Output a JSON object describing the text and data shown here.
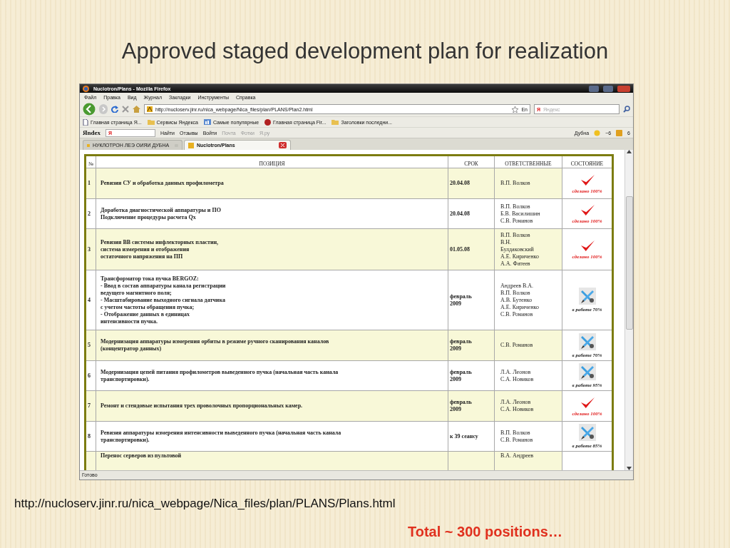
{
  "slide": {
    "title": "Approved staged development plan for realization",
    "source_url": "http://nucloserv.jinr.ru/nica_webpage/Nica_files/plan/PLANS/Plans.html",
    "footer_note": "Total ~ 300 positions…"
  },
  "browser": {
    "window_title": "Nuclotron/Plans - Mozilla Firefox",
    "menu": [
      "Файл",
      "Правка",
      "Вид",
      "Журнал",
      "Закладки",
      "Инструменты",
      "Справка"
    ],
    "address": "http://nucloserv.jinr.ru/nica_webpage/Nica_files/plan/PLANS/Plan2.html",
    "language": "En",
    "search_engine": "Я",
    "search_placeholder": "Яндекс",
    "bookmarks": [
      {
        "label": "Главная страница Я...",
        "kind": "page"
      },
      {
        "label": "Сервисы Яндекса",
        "kind": "folder"
      },
      {
        "label": "Самые популярные",
        "kind": "smart"
      },
      {
        "label": "Главная страница Fir...",
        "kind": "firefox"
      },
      {
        "label": "Заголовки последни...",
        "kind": "folder"
      }
    ],
    "yandex_bar": {
      "logo": "Яndex",
      "field_value": "Я",
      "items": [
        {
          "label": "Найти",
          "disabled": false
        },
        {
          "label": "Отзывы",
          "disabled": false
        },
        {
          "label": "Войти",
          "disabled": false
        },
        {
          "label": "Почта",
          "disabled": true
        },
        {
          "label": "Фотки",
          "disabled": true
        },
        {
          "label": "Я.ру",
          "disabled": true
        }
      ],
      "city": "Дубна",
      "temperature": "−6",
      "mail_count": "6"
    },
    "tabs": [
      {
        "label": "НУКЛОТРОН ЛЕЭ ОИЯИ ДУБНА",
        "selected": false
      },
      {
        "label": "Nuclotron/Plans",
        "selected": true
      }
    ],
    "status_bar": "Готово"
  },
  "table": {
    "columns": [
      "№",
      "ПОЗИЦИЯ",
      "СРОК",
      "ОТВЕТСТВЕННЫЕ",
      "СОСТОЯНИЕ"
    ],
    "rows": [
      {
        "number": "1",
        "position": "Ревизия СУ и обработка данных профилометра",
        "deadline": "20.04.08",
        "responsible": "В.П. Волков",
        "status": {
          "kind": "done",
          "label": "сделано 100%"
        }
      },
      {
        "number": "2",
        "position": "Доработка диагностической аппаратуры и ПО\nПодключение процедуры расчета Qx",
        "deadline": "20.04.08",
        "responsible": "В.П. Волков\nБ.В. Василишин\nС.В. Романов",
        "status": {
          "kind": "done",
          "label": "сделано 100%"
        }
      },
      {
        "number": "3",
        "position": "Ревизия ВВ системы инфлекторных пластин,\nсистема измерения и отображения\nостаточного напряжения на ПП",
        "deadline": "01.05.08",
        "responsible": "В.П. Волков\nВ.Н.\nБулдаковский\nА.Е. Кириченко\nА.А. Фатеев",
        "status": {
          "kind": "done",
          "label": "сделано 100%"
        }
      },
      {
        "number": "4",
        "position": "Трансформатор тока пучка BERGOZ:\n- Ввод в состав аппаратуры канала регистрации\nведущего магнитного поля;\n- Масштабирование выходного сигнала датчика\nс учетом частоты обращения пучка;\n- Отображение данных в единицах\nинтенсивности пучка.",
        "deadline": "февраль\n2009",
        "responsible": "Андреев В.А.\nВ.П. Волков\nА.В. Бутенко\nА.Е. Кириченко\nС.В. Романов",
        "status": {
          "kind": "in_progress",
          "label": "в работе 70%"
        }
      },
      {
        "number": "5",
        "position": "Модернизация аппаратуры измерения орбиты в режиме ручного сканирования каналов\n(концентратор данных)",
        "deadline": "февраль\n2009",
        "responsible": "С.В. Романов",
        "status": {
          "kind": "in_progress",
          "label": "в работе 70%"
        }
      },
      {
        "number": "6",
        "position": "Модернизация цепей питания профилометров выведенного пучка (начальная часть канала\nтранспортировки).",
        "deadline": "февраль\n2009",
        "responsible": "Л.А. Леонов\nС.А. Новиков",
        "status": {
          "kind": "in_progress",
          "label": "в работе 95%"
        }
      },
      {
        "number": "7",
        "position": "Ремонт и стендовые испытания трех проволочных пропорциональных камер.",
        "deadline": "февраль\n2009",
        "responsible": "Л.А. Леонов\nС.А. Новиков",
        "status": {
          "kind": "done",
          "label": "сделано 100%"
        }
      },
      {
        "number": "8",
        "position": "Ревизия аппаратуры измерения интенсивности выведенного пучка (начальная часть канала\nтранспортировки).",
        "deadline": "к 39 сеансу",
        "responsible": "В.П. Волков\nС.В. Романов",
        "status": {
          "kind": "in_progress",
          "label": "в работе 85%"
        }
      },
      {
        "position": "Перенос серверов из пультовой",
        "responsible": "В.А. Андреев"
      }
    ]
  }
}
